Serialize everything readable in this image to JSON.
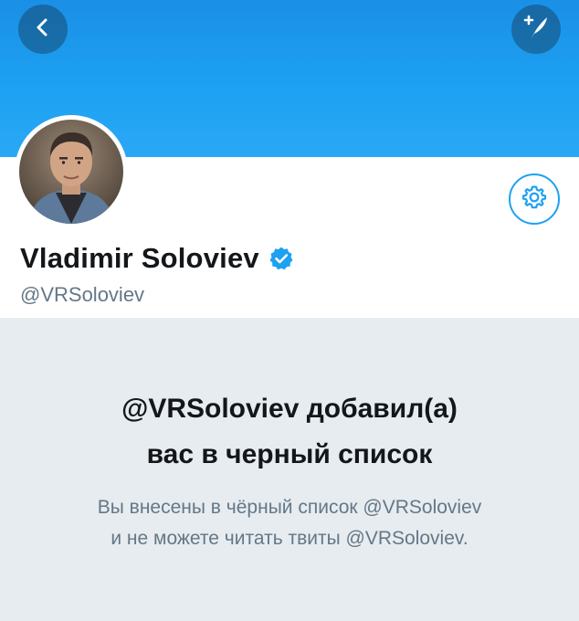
{
  "header": {
    "back_icon": "chevron-left-icon",
    "compose_icon": "compose-tweet-icon",
    "banner_color": "#1da1f2"
  },
  "profile": {
    "display_name": "Vladimir Soloviev",
    "handle": "@VRSoloviev",
    "verified": true,
    "verified_icon": "verified-badge-icon",
    "settings_icon": "gear-icon",
    "accent_color": "#1da1f2"
  },
  "blocked_notice": {
    "title_line1": "@VRSoloviev добавил(а)",
    "title_line2": "вас в черный список",
    "description_line1": "Вы внесены в чёрный список @VRSoloviev",
    "description_line2": "и не можете читать твиты @VRSoloviev."
  }
}
